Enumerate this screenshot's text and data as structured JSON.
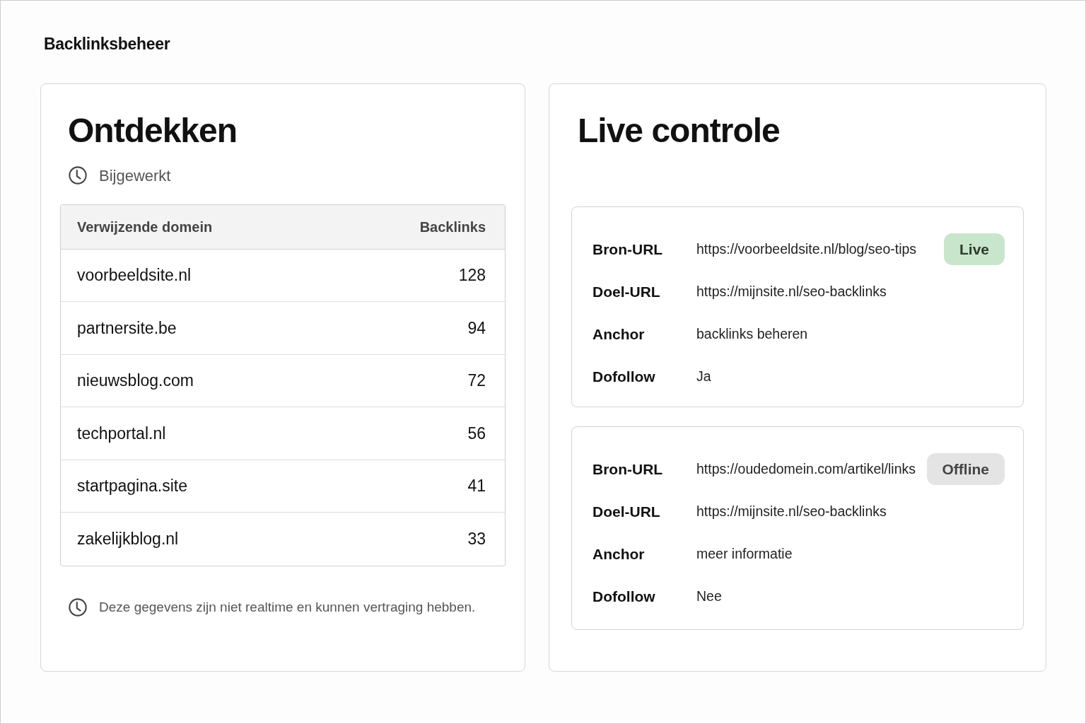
{
  "page_title": "Backlinksbeheer",
  "discover": {
    "title": "Ontdekken",
    "updated": "Bijgewerkt",
    "table": {
      "columns": [
        "Verwijzende domein",
        "Backlinks"
      ],
      "rows": [
        [
          "voorbeeldsite.nl",
          "128"
        ],
        [
          "partnersite.be",
          "94"
        ],
        [
          "nieuwsblog.com",
          "72"
        ],
        [
          "techportal.nl",
          "56"
        ],
        [
          "startpagina.site",
          "41"
        ],
        [
          "zakelijkblog.nl",
          "33"
        ]
      ]
    },
    "note": "Deze gegevens zijn niet realtime en kunnen vertraging hebben."
  },
  "live_check": {
    "title": "Live controle",
    "links": [
      {
        "kind": "live",
        "badge": "Live",
        "fields": [
          {
            "label": "Bron-URL",
            "value": "https://voorbeeldsite.nl/blog/seo-tips"
          },
          {
            "label": "Doel-URL",
            "value": "https://mijnsite.nl/seo-backlinks"
          },
          {
            "label": "Anchor",
            "value": "backlinks beheren"
          },
          {
            "label": "Dofollow",
            "value": "Ja"
          }
        ]
      },
      {
        "kind": "offline",
        "badge": "Offline",
        "fields": [
          {
            "label": "Bron-URL",
            "value": "https://oudedomein.com/artikel/links"
          },
          {
            "label": "Doel-URL",
            "value": "https://mijnsite.nl/seo-backlinks"
          },
          {
            "label": "Anchor",
            "value": "meer informatie"
          },
          {
            "label": "Dofollow",
            "value": "Nee"
          }
        ]
      }
    ]
  }
}
